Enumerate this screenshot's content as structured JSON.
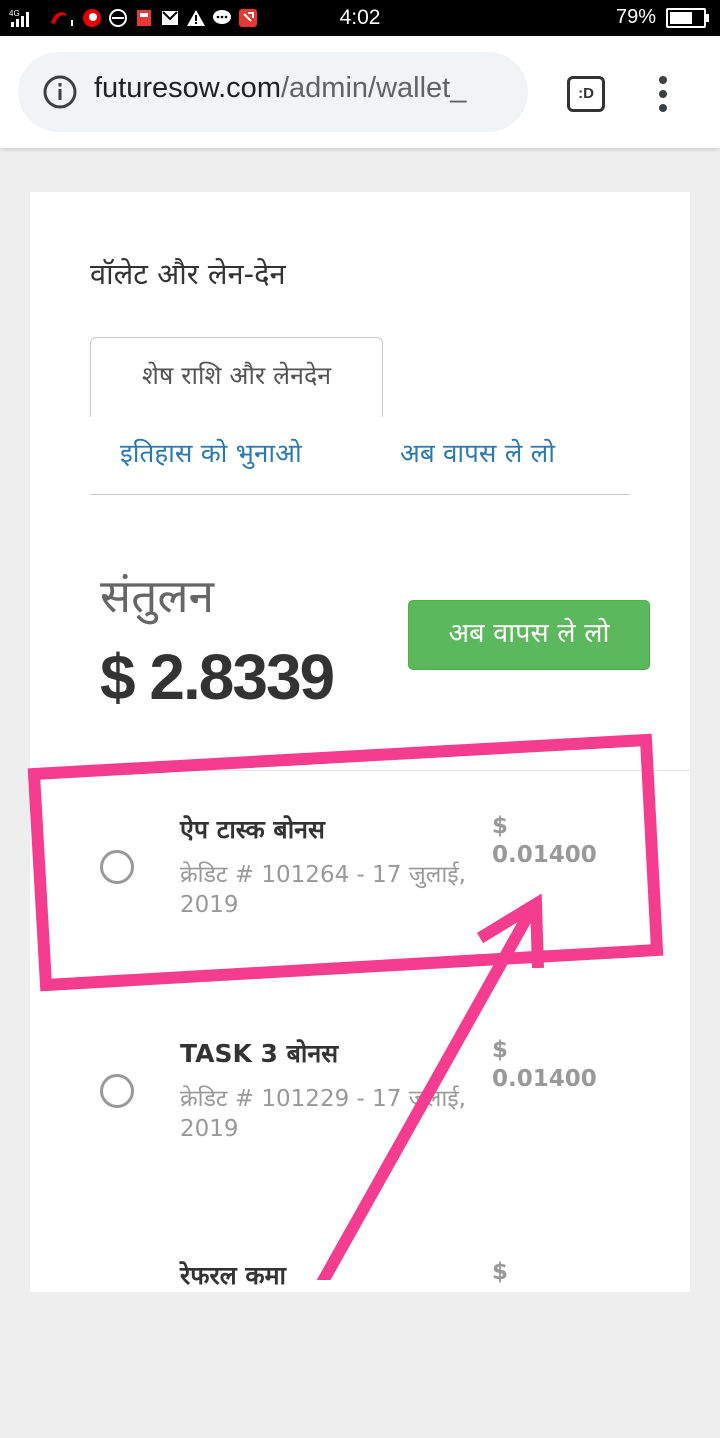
{
  "status_bar": {
    "time": "4:02",
    "battery_percent": "79%",
    "battery_level": 0.79,
    "network": "4G",
    "icons": [
      "signal-icon",
      "airtel-icon",
      "vodafone-icon",
      "ie-icon",
      "save-icon",
      "gmail-icon",
      "warning-icon",
      "chat-icon",
      "missed-call-icon"
    ]
  },
  "browser": {
    "url_domain": "futuresow.com",
    "url_path": "/admin/wallet_",
    "tab_switch_label": ":D"
  },
  "page": {
    "heading": "वॉलेट और लेन-देन",
    "tabs": [
      {
        "label": "शेष राशि और लेनदेन",
        "active": true
      },
      {
        "label": "इतिहास को भुनाओ",
        "active": false
      },
      {
        "label": "अब वापस ले लो",
        "active": false
      }
    ],
    "balance_label": "संतुलन",
    "balance_value": "$ 2.8339",
    "withdraw_button": "अब वापस ले लो"
  },
  "transactions": [
    {
      "title": "ऐप टास्क बोनस",
      "detail": "क्रेडिट # 101264 - 17 जुलाई, 2019",
      "currency": "$",
      "amount": "0.01400"
    },
    {
      "title": "TASK 3 बोनस",
      "detail": "क्रेडिट # 101229 - 17 जुलाई, 2019",
      "currency": "$",
      "amount": "0.01400"
    },
    {
      "title": "रेफरल कमा",
      "detail": "",
      "currency": "$",
      "amount": ""
    }
  ],
  "colors": {
    "accent_link": "#2b79b4",
    "button_green": "#5cb85c",
    "annotation_pink": "#f43d8f"
  }
}
